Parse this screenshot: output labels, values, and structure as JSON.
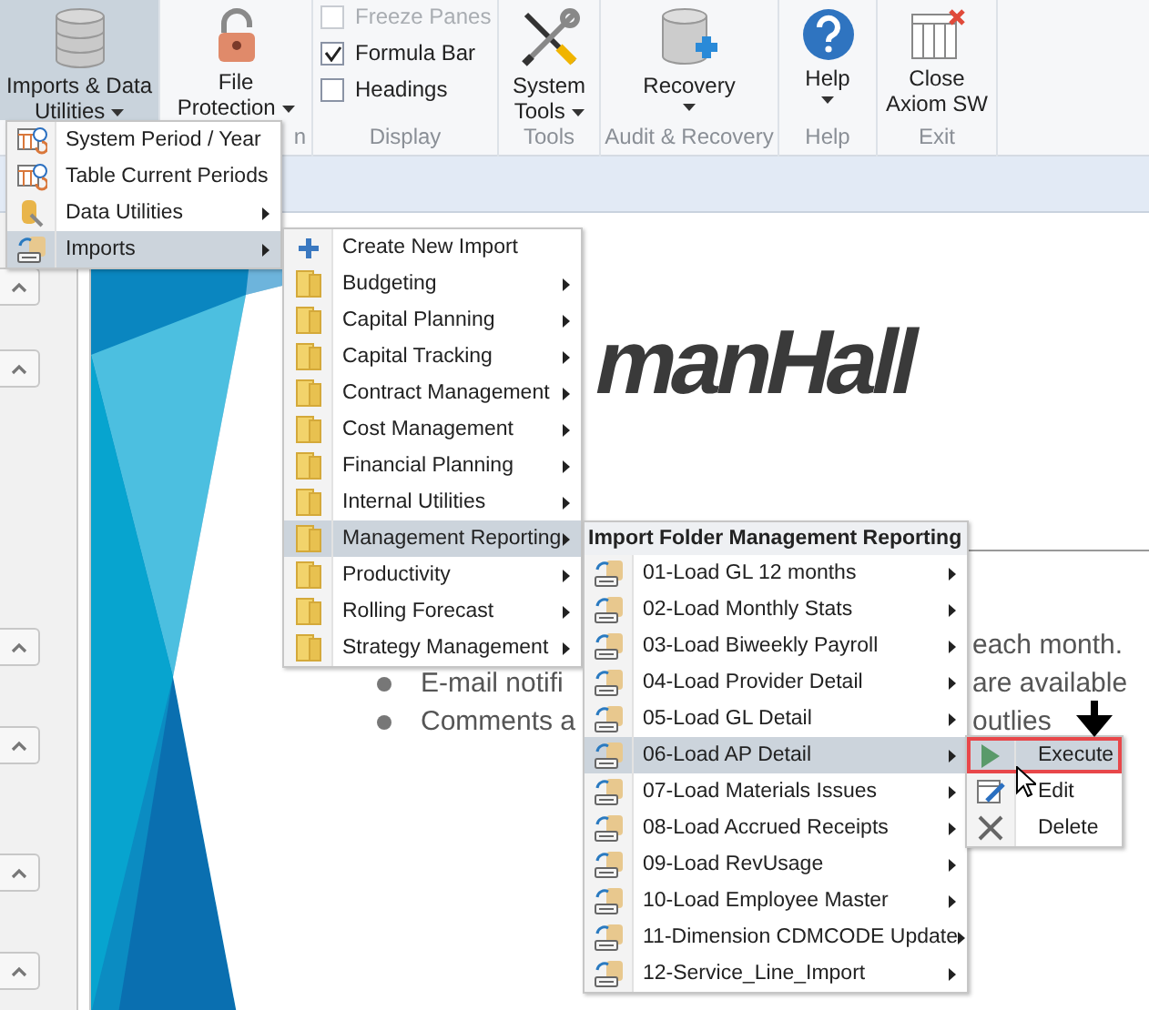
{
  "ribbon": {
    "groups": [
      {
        "kind": "large",
        "lines": [
          "Imports & Data",
          "Utilities"
        ],
        "dropdown": true,
        "selected": true
      },
      {
        "kind": "large",
        "lines": [
          "File",
          "Protection"
        ],
        "dropdown": true,
        "selected": false,
        "label": "n"
      },
      {
        "kind": "checks",
        "label": "Display",
        "checks": [
          {
            "label": "Freeze Panes",
            "checked": false,
            "disabled": true
          },
          {
            "label": "Formula Bar",
            "checked": true,
            "disabled": false
          },
          {
            "label": "Headings",
            "checked": false,
            "disabled": false
          }
        ]
      },
      {
        "kind": "large",
        "lines": [
          "System",
          "Tools"
        ],
        "dropdown": true,
        "selected": false,
        "label": "Tools"
      },
      {
        "kind": "large",
        "lines": [
          "Recovery"
        ],
        "dropdown": true,
        "selected": false,
        "label": "Audit & Recovery"
      },
      {
        "kind": "large",
        "lines": [
          "Help"
        ],
        "dropdown": true,
        "selected": false,
        "label": "Help"
      },
      {
        "kind": "large",
        "lines": [
          "Close",
          "Axiom SW"
        ],
        "dropdown": false,
        "selected": false,
        "label": "Exit"
      }
    ]
  },
  "slide": {
    "title": "manHall",
    "bullets": [
      {
        "right": "each month."
      },
      {
        "left": "E-mail notifi",
        "right": "are available"
      },
      {
        "left": "Comments a",
        "right": "outlies"
      }
    ]
  },
  "menus": [
    {
      "items": [
        {
          "label": "System Period / Year",
          "submenu": false,
          "selected": false
        },
        {
          "label": "Table Current Periods",
          "submenu": false,
          "selected": false
        },
        {
          "label": "Data Utilities",
          "submenu": true,
          "selected": false
        },
        {
          "label": "Imports",
          "submenu": true,
          "selected": true
        }
      ]
    },
    {
      "items": [
        {
          "label": "Create New Import",
          "submenu": false,
          "selected": false
        },
        {
          "label": "Budgeting",
          "submenu": true,
          "selected": false
        },
        {
          "label": "Capital Planning",
          "submenu": true,
          "selected": false
        },
        {
          "label": "Capital Tracking",
          "submenu": true,
          "selected": false
        },
        {
          "label": "Contract Management",
          "submenu": true,
          "selected": false
        },
        {
          "label": "Cost Management",
          "submenu": true,
          "selected": false
        },
        {
          "label": "Financial Planning",
          "submenu": true,
          "selected": false
        },
        {
          "label": "Internal Utilities",
          "submenu": true,
          "selected": false
        },
        {
          "label": "Management Reporting",
          "submenu": true,
          "selected": true
        },
        {
          "label": "Productivity",
          "submenu": true,
          "selected": false
        },
        {
          "label": "Rolling Forecast",
          "submenu": true,
          "selected": false
        },
        {
          "label": "Strategy Management",
          "submenu": true,
          "selected": false
        }
      ]
    },
    {
      "header": "Import Folder Management Reporting",
      "items": [
        {
          "label": "01-Load GL 12 months",
          "submenu": true,
          "selected": false
        },
        {
          "label": "02-Load Monthly Stats",
          "submenu": true,
          "selected": false
        },
        {
          "label": "03-Load Biweekly Payroll",
          "submenu": true,
          "selected": false
        },
        {
          "label": "04-Load Provider Detail",
          "submenu": true,
          "selected": false
        },
        {
          "label": "05-Load GL Detail",
          "submenu": true,
          "selected": false
        },
        {
          "label": "06-Load AP Detail",
          "submenu": true,
          "selected": true
        },
        {
          "label": "07-Load Materials Issues",
          "submenu": true,
          "selected": false
        },
        {
          "label": "08-Load Accrued Receipts",
          "submenu": true,
          "selected": false
        },
        {
          "label": "09-Load RevUsage",
          "submenu": true,
          "selected": false
        },
        {
          "label": "10-Load Employee Master",
          "submenu": true,
          "selected": false
        },
        {
          "label": "11-Dimension CDMCODE Update",
          "submenu": true,
          "selected": false
        },
        {
          "label": "12-Service_Line_Import",
          "submenu": true,
          "selected": false
        }
      ]
    },
    {
      "items": [
        {
          "label": "Execute",
          "submenu": false,
          "selected": true
        },
        {
          "label": "Edit",
          "submenu": false,
          "selected": false
        },
        {
          "label": "Delete",
          "submenu": false,
          "selected": false
        }
      ]
    }
  ]
}
